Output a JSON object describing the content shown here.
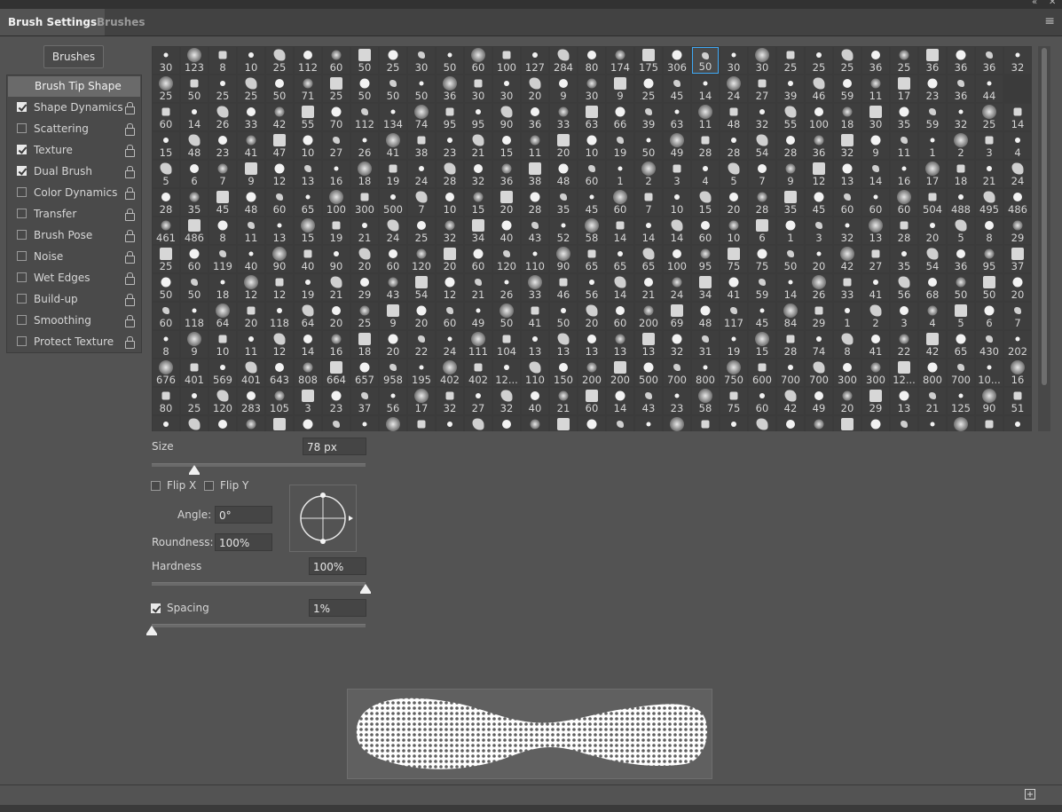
{
  "window": {
    "collapse_icon": "double-chevron-icon",
    "close_icon": "close-icon",
    "tabs": [
      {
        "label": "Brush Settings",
        "active": true
      },
      {
        "label": "Brushes",
        "active": false
      }
    ],
    "menu_icon": "panel-menu-icon"
  },
  "sidebar": {
    "brushes_button": "Brushes",
    "items": [
      {
        "label": "Brush Tip Shape",
        "has_checkbox": false,
        "checked": false,
        "active": true,
        "lock": false
      },
      {
        "label": "Shape Dynamics",
        "has_checkbox": true,
        "checked": true,
        "active": false,
        "lock": true
      },
      {
        "label": "Scattering",
        "has_checkbox": true,
        "checked": false,
        "active": false,
        "lock": true
      },
      {
        "label": "Texture",
        "has_checkbox": true,
        "checked": true,
        "active": false,
        "lock": true
      },
      {
        "label": "Dual Brush",
        "has_checkbox": true,
        "checked": true,
        "active": false,
        "lock": true
      },
      {
        "label": "Color Dynamics",
        "has_checkbox": true,
        "checked": false,
        "active": false,
        "lock": true
      },
      {
        "label": "Transfer",
        "has_checkbox": true,
        "checked": false,
        "active": false,
        "lock": true
      },
      {
        "label": "Brush Pose",
        "has_checkbox": true,
        "checked": false,
        "active": false,
        "lock": true
      },
      {
        "label": "Noise",
        "has_checkbox": true,
        "checked": false,
        "active": false,
        "lock": true
      },
      {
        "label": "Wet Edges",
        "has_checkbox": true,
        "checked": false,
        "active": false,
        "lock": true
      },
      {
        "label": "Build-up",
        "has_checkbox": true,
        "checked": false,
        "active": false,
        "lock": true
      },
      {
        "label": "Smoothing",
        "has_checkbox": true,
        "checked": false,
        "active": false,
        "lock": true
      },
      {
        "label": "Protect Texture",
        "has_checkbox": true,
        "checked": false,
        "active": false,
        "lock": true
      }
    ]
  },
  "brush_tips": {
    "selected": {
      "row": 0,
      "col": 19
    },
    "rows": [
      [
        "30",
        "123",
        "8",
        "10",
        "25",
        "112",
        "60",
        "50",
        "25",
        "30",
        "50",
        "60",
        "100",
        "127",
        "284",
        "80",
        "174",
        "175",
        "306",
        "50",
        "30",
        "30",
        "25",
        "25",
        "25",
        "36",
        "25",
        "36",
        "36",
        "36",
        "32"
      ],
      [
        "25",
        "50",
        "25",
        "25",
        "50",
        "71",
        "25",
        "50",
        "50",
        "50",
        "36",
        "30",
        "30",
        "20",
        "9",
        "30",
        "9",
        "25",
        "45",
        "14",
        "24",
        "27",
        "39",
        "46",
        "59",
        "11",
        "17",
        "23",
        "36",
        "44"
      ],
      [
        "60",
        "14",
        "26",
        "33",
        "42",
        "55",
        "70",
        "112",
        "134",
        "74",
        "95",
        "95",
        "90",
        "36",
        "33",
        "63",
        "66",
        "39",
        "63",
        "11",
        "48",
        "32",
        "55",
        "100",
        "18",
        "30",
        "35",
        "59",
        "32",
        "25",
        "14"
      ],
      [
        "15",
        "48",
        "23",
        "41",
        "47",
        "10",
        "27",
        "26",
        "41",
        "38",
        "23",
        "21",
        "15",
        "11",
        "20",
        "10",
        "19",
        "50",
        "49",
        "28",
        "28",
        "54",
        "28",
        "36",
        "32",
        "9",
        "11",
        "1",
        "2",
        "3",
        "4"
      ],
      [
        "5",
        "6",
        "7",
        "9",
        "12",
        "13",
        "16",
        "18",
        "19",
        "24",
        "28",
        "32",
        "36",
        "38",
        "48",
        "60",
        "1",
        "2",
        "3",
        "4",
        "5",
        "7",
        "9",
        "12",
        "13",
        "14",
        "16",
        "17",
        "18",
        "21",
        "24"
      ],
      [
        "28",
        "35",
        "45",
        "48",
        "60",
        "65",
        "100",
        "300",
        "500",
        "7",
        "10",
        "15",
        "20",
        "28",
        "35",
        "45",
        "60",
        "7",
        "10",
        "15",
        "20",
        "28",
        "35",
        "45",
        "60",
        "60",
        "60",
        "504",
        "488",
        "495",
        "486"
      ],
      [
        "461",
        "486",
        "8",
        "11",
        "13",
        "15",
        "19",
        "21",
        "24",
        "25",
        "32",
        "34",
        "40",
        "43",
        "52",
        "58",
        "14",
        "14",
        "14",
        "60",
        "10",
        "6",
        "1",
        "3",
        "32",
        "13",
        "28",
        "20",
        "5",
        "8",
        "29"
      ],
      [
        "25",
        "60",
        "119",
        "40",
        "90",
        "40",
        "90",
        "20",
        "60",
        "120",
        "20",
        "60",
        "120",
        "110",
        "90",
        "65",
        "65",
        "65",
        "100",
        "95",
        "75",
        "75",
        "50",
        "20",
        "42",
        "27",
        "35",
        "54",
        "36",
        "95",
        "37"
      ],
      [
        "50",
        "50",
        "18",
        "12",
        "12",
        "19",
        "21",
        "29",
        "43",
        "54",
        "12",
        "21",
        "26",
        "33",
        "46",
        "56",
        "14",
        "21",
        "24",
        "34",
        "41",
        "59",
        "14",
        "26",
        "33",
        "41",
        "56",
        "68",
        "50",
        "50",
        "20"
      ],
      [
        "60",
        "118",
        "64",
        "20",
        "118",
        "64",
        "20",
        "25",
        "9",
        "20",
        "60",
        "49",
        "50",
        "41",
        "50",
        "20",
        "60",
        "200",
        "69",
        "48",
        "117",
        "45",
        "84",
        "29",
        "1",
        "2",
        "3",
        "4",
        "5",
        "6",
        "7"
      ],
      [
        "8",
        "9",
        "10",
        "11",
        "12",
        "14",
        "16",
        "18",
        "20",
        "22",
        "24",
        "111",
        "104",
        "13",
        "13",
        "13",
        "13",
        "13",
        "32",
        "31",
        "19",
        "15",
        "28",
        "74",
        "8",
        "41",
        "22",
        "42",
        "65",
        "430",
        "202"
      ],
      [
        "676",
        "401",
        "569",
        "401",
        "643",
        "808",
        "664",
        "657",
        "958",
        "195",
        "402",
        "402",
        "12...",
        "110",
        "150",
        "200",
        "200",
        "500",
        "700",
        "800",
        "750",
        "600",
        "700",
        "700",
        "300",
        "300",
        "12...",
        "800",
        "700",
        "10...",
        "16"
      ],
      [
        "80",
        "25",
        "120",
        "283",
        "105",
        "3",
        "23",
        "37",
        "56",
        "17",
        "32",
        "27",
        "32",
        "40",
        "21",
        "60",
        "14",
        "43",
        "23",
        "58",
        "75",
        "60",
        "42",
        "49",
        "20",
        "29",
        "13",
        "21",
        "125",
        "90",
        "51"
      ],
      [
        "",
        "",
        "",
        "",
        "",
        "",
        "",
        "",
        "",
        "",
        "",
        "",
        "",
        "",
        "",
        "",
        "",
        "",
        "",
        "",
        "",
        "",
        "",
        "",
        "",
        "",
        "",
        "",
        "",
        "",
        ""
      ]
    ]
  },
  "controls": {
    "size_label": "Size",
    "size_value": "78 px",
    "size_slider_fraction": 0.2,
    "flip_x_label": "Flip X",
    "flip_y_label": "Flip Y",
    "flip_x_checked": false,
    "flip_y_checked": false,
    "angle_label": "Angle:",
    "angle_value": "0°",
    "roundness_label": "Roundness:",
    "roundness_value": "100%",
    "hardness_label": "Hardness",
    "hardness_value": "100%",
    "hardness_slider_fraction": 1.0,
    "spacing_label": "Spacing",
    "spacing_checked": true,
    "spacing_value": "1%",
    "spacing_slider_fraction": 0.0
  },
  "footer": {
    "new_brush_icon": "create-new-brush-icon"
  },
  "colors": {
    "panel_bg": "#535353",
    "selection": "#3fa9f5",
    "text": "#d6d6d6"
  }
}
